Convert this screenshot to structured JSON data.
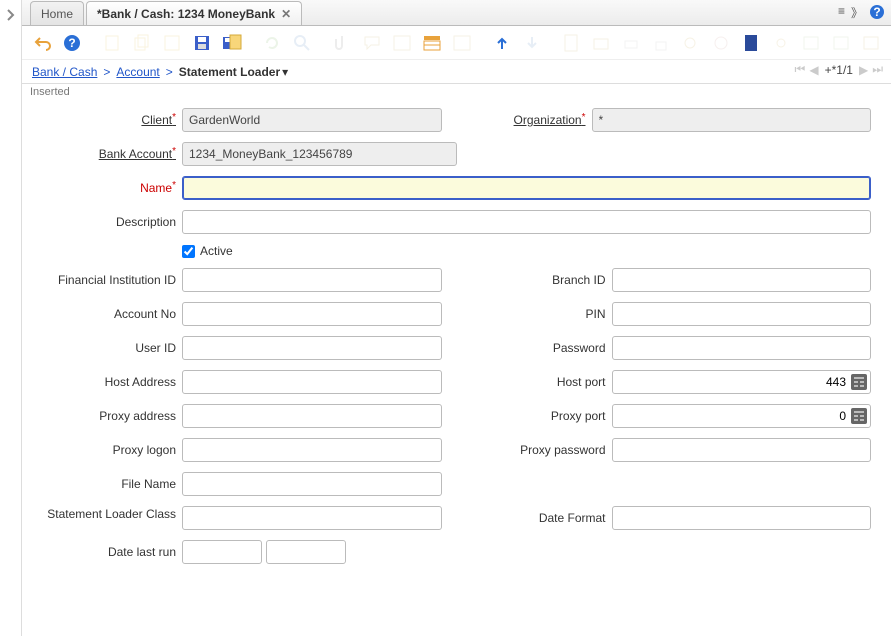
{
  "tabs": [
    {
      "label": "Home",
      "closable": false,
      "active": false
    },
    {
      "label": "*Bank / Cash: 1234 MoneyBank",
      "closable": true,
      "active": true
    }
  ],
  "breadcrumb": {
    "links": [
      "Bank / Cash",
      "Account"
    ],
    "current": "Statement Loader"
  },
  "nav": {
    "page": "+*1/1"
  },
  "status": "Inserted",
  "form": {
    "client": {
      "label": "Client",
      "value": "GardenWorld"
    },
    "organization": {
      "label": "Organization",
      "value": "*"
    },
    "bank_account": {
      "label": "Bank Account",
      "value": "1234_MoneyBank_123456789"
    },
    "name": {
      "label": "Name",
      "value": ""
    },
    "description": {
      "label": "Description",
      "value": ""
    },
    "active": {
      "label": "Active",
      "checked": true
    },
    "financial_institution_id": {
      "label": "Financial Institution ID",
      "value": ""
    },
    "branch_id": {
      "label": "Branch ID",
      "value": ""
    },
    "account_no": {
      "label": "Account No",
      "value": ""
    },
    "pin": {
      "label": "PIN",
      "value": ""
    },
    "user_id": {
      "label": "User ID",
      "value": ""
    },
    "password": {
      "label": "Password",
      "value": ""
    },
    "host_address": {
      "label": "Host Address",
      "value": ""
    },
    "host_port": {
      "label": "Host port",
      "value": "443"
    },
    "proxy_address": {
      "label": "Proxy address",
      "value": ""
    },
    "proxy_port": {
      "label": "Proxy port",
      "value": "0"
    },
    "proxy_logon": {
      "label": "Proxy logon",
      "value": ""
    },
    "proxy_password": {
      "label": "Proxy password",
      "value": ""
    },
    "file_name": {
      "label": "File Name",
      "value": ""
    },
    "statement_loader_class": {
      "label": "Statement Loader Class",
      "value": ""
    },
    "date_format": {
      "label": "Date Format",
      "value": ""
    },
    "date_last_run": {
      "label": "Date last run",
      "value": ""
    }
  }
}
